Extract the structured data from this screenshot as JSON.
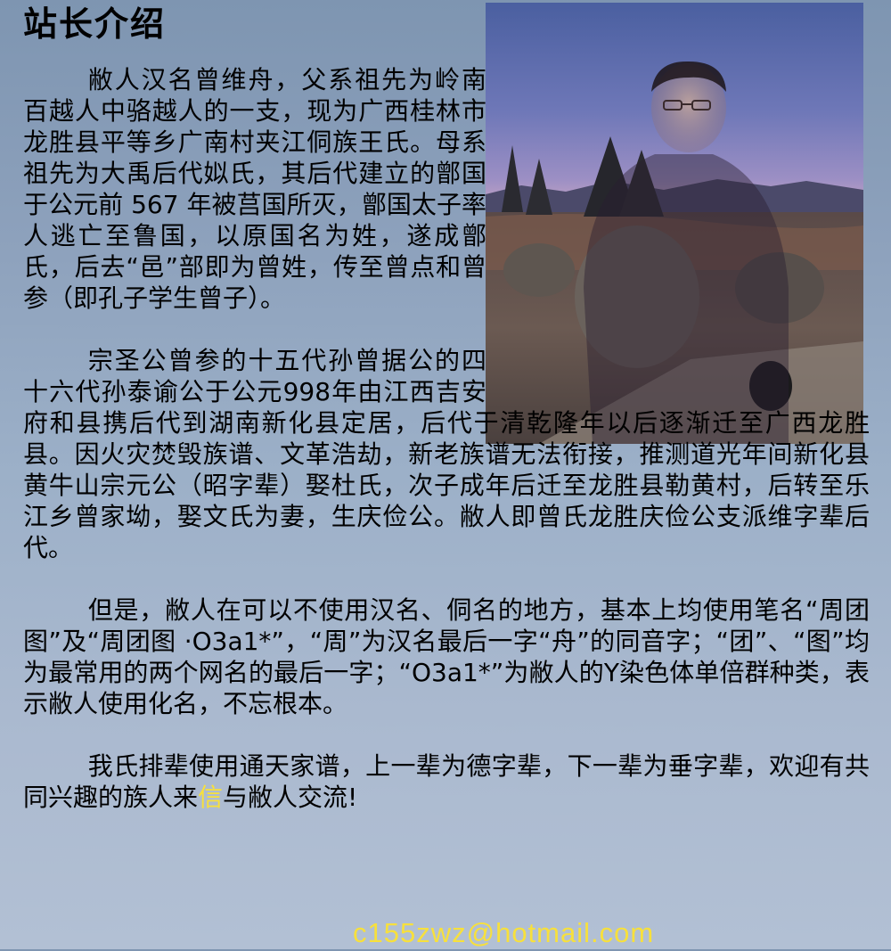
{
  "title": "站长介绍",
  "paragraphs": [
    "敝人汉名曾维舟，父系祖先为岭南百越人中骆越人的一支，现为广西桂林市龙胜县平等乡广南村夹江侗族王氏。母系祖先为大禹后代姒氏，其后代建立的鄫国于公元前 567 年被莒国所灭，鄫国太子率人逃亡至鲁国，以原国名为姓，遂成鄫氏，后去“邑”部即为曾姓，传至曾点和曾参（即孔子学生曾子）。",
    "宗圣公曾参的十五代孙曾据公的四十六代孙泰谕公于公元998年由江西吉安府和县携后代到湖南新化县定居，后代于清乾隆年以后逐渐迁至广西龙胜县。因火灾焚毁族谱、文革浩劫，新老族谱无法衔接，推测道光年间新化县黄牛山宗元公（昭字辈）娶杜氏，次子成年后迁至龙胜县勒黄村，后转至乐江乡曾家坳，娶文氏为妻，生庆俭公。敝人即曾氏龙胜庆俭公支派维字辈后代。",
    "但是，敝人在可以不使用汉名、侗名的地方，基本上均使用笔名“周团图”及“周团图 ·O3a1*”，“周”为汉名最后一字“舟”的同音字；“团”、“图”均为最常用的两个网名的最后一字；“O3a1*”为敝人的Y染色体单倍群种类，表示敝人使用化名，不忘根本。"
  ],
  "last_paragraph": {
    "before": "我氏排辈使用通天家谱，上一辈为德字辈，下一辈为垂字辈，欢迎有共同兴趣的族人来",
    "highlight": "信",
    "after": "与敝人交流!"
  },
  "email": "c155zwz@hotmail.com",
  "photo": {
    "alt": "photo of the site owner superimposed on a dusk landscape"
  },
  "colors": {
    "background_top": "#7e95b1",
    "background_bottom": "#b2c0d4",
    "highlight": "#f7e03c",
    "text": "#000000"
  }
}
